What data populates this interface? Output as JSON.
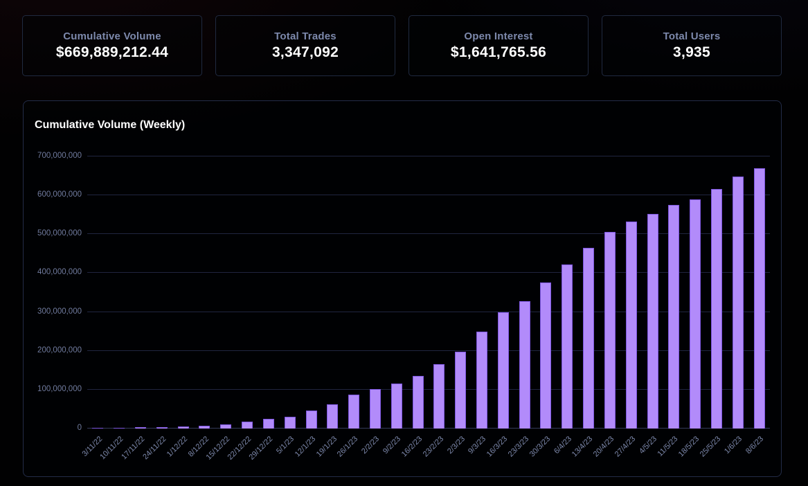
{
  "stats": [
    {
      "label": "Cumulative Volume",
      "value": "$669,889,212.44"
    },
    {
      "label": "Total Trades",
      "value": "3,347,092"
    },
    {
      "label": "Open Interest",
      "value": "$1,641,765.56"
    },
    {
      "label": "Total Users",
      "value": "3,935"
    }
  ],
  "chart_data": {
    "type": "bar",
    "title": "Cumulative Volume (Weekly)",
    "categories": [
      "3/11/22",
      "10/11/22",
      "17/11/22",
      "24/11/22",
      "1/12/22",
      "8/12/22",
      "15/12/22",
      "22/12/22",
      "29/12/22",
      "5/1/23",
      "12/1/23",
      "19/1/23",
      "26/1/23",
      "2/2/23",
      "9/2/23",
      "16/2/23",
      "23/2/23",
      "2/3/23",
      "9/3/23",
      "16/3/23",
      "23/3/23",
      "30/3/23",
      "6/4/23",
      "13/4/23",
      "20/4/23",
      "27/4/23",
      "4/5/23",
      "11/5/23",
      "18/5/23",
      "25/5/23",
      "1/6/23",
      "8/6/23"
    ],
    "values": [
      800000,
      1500000,
      2800000,
      3600000,
      4800000,
      7000000,
      10500000,
      17000000,
      25000000,
      31000000,
      47000000,
      62000000,
      88000000,
      101000000,
      115000000,
      135000000,
      166000000,
      197000000,
      250000000,
      299000000,
      328000000,
      375000000,
      422000000,
      465000000,
      505000000,
      533000000,
      553000000,
      575000000,
      589000000,
      617000000,
      649000000,
      669889212
    ],
    "xlabel": "",
    "ylabel": "",
    "ylim": [
      0,
      700000000
    ],
    "ytick_step": 100000000,
    "ytick_labels": [
      "0",
      "100,000,000",
      "200,000,000",
      "300,000,000",
      "400,000,000",
      "500,000,000",
      "600,000,000",
      "700,000,000"
    ],
    "grid": "horizontal",
    "legend": "none",
    "bar_color": "#b28bfa",
    "bar_border_color": "#7d57e0"
  },
  "colors": {
    "background": "#010102",
    "card_border": "#202a40",
    "stat_label": "#7d89ac",
    "stat_value": "#ffffff",
    "gridline": "#202540",
    "axis_text": "#707b9e"
  }
}
